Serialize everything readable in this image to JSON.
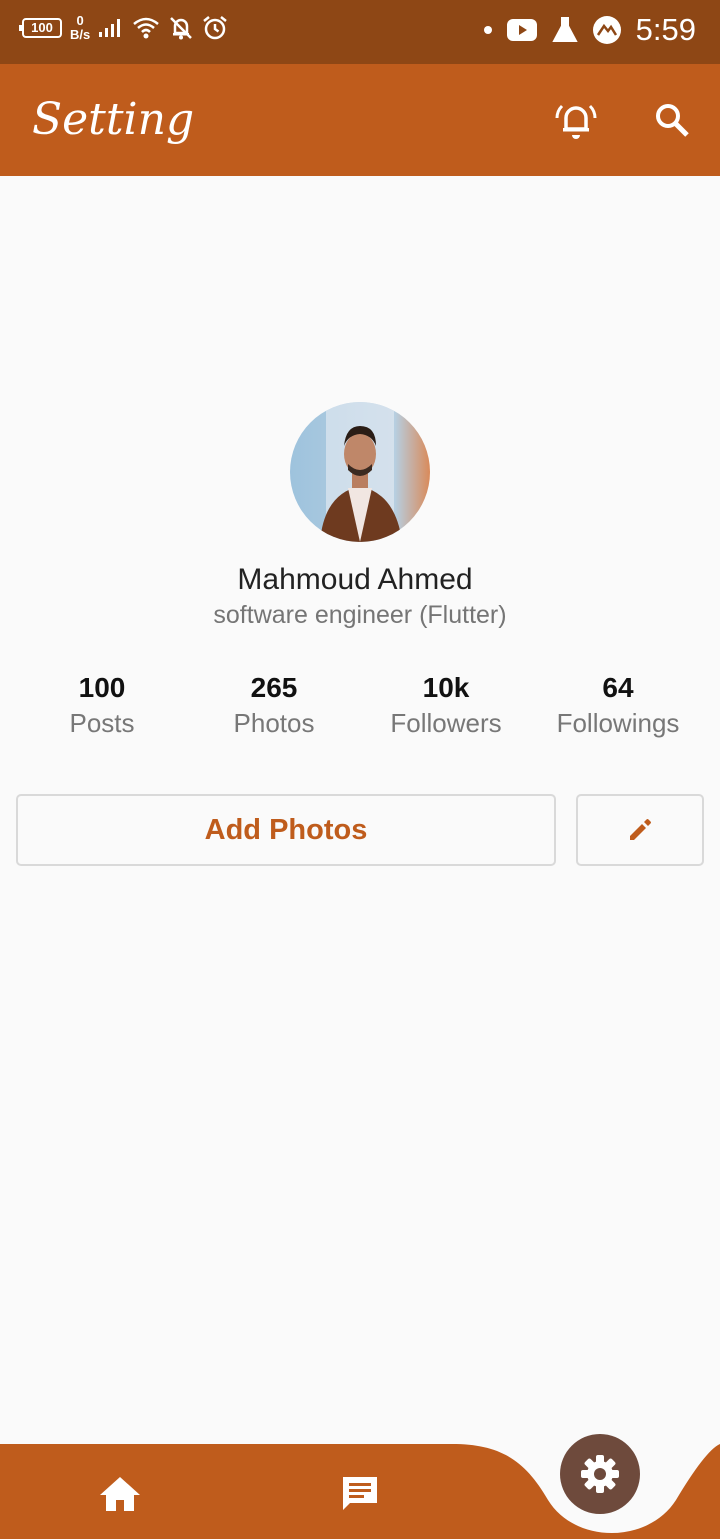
{
  "status_bar": {
    "battery": "100",
    "net_speed_value": "0",
    "net_speed_unit": "B/s",
    "time": "5:59"
  },
  "app_bar": {
    "title": "Setting",
    "icons": [
      "notifications-icon",
      "search-icon"
    ]
  },
  "profile": {
    "name": "Mahmoud Ahmed",
    "bio": "software engineer (Flutter)"
  },
  "stats": [
    {
      "value": "100",
      "label": "Posts"
    },
    {
      "value": "265",
      "label": "Photos"
    },
    {
      "value": "10k",
      "label": "Followers"
    },
    {
      "value": "64",
      "label": "Followings"
    }
  ],
  "actions": {
    "add_photos_label": "Add Photos",
    "edit_icon": "edit-icon"
  },
  "bottom_nav": {
    "items": [
      "home-icon",
      "chat-icon",
      "settings-icon"
    ],
    "active": "settings-icon"
  },
  "colors": {
    "primary": "#bf5c1c",
    "status_bar": "#8e4715",
    "fab": "#6e4a3c",
    "background": "#fafafa"
  }
}
